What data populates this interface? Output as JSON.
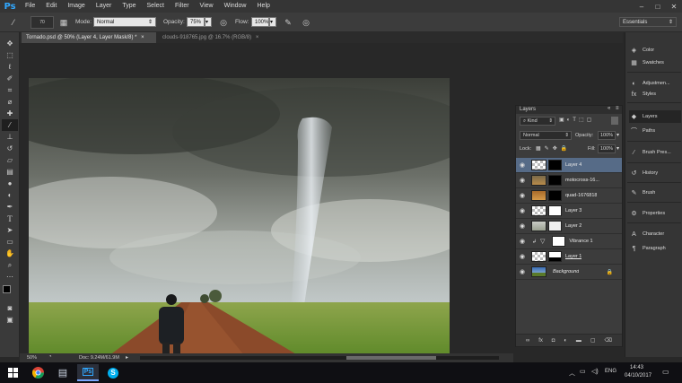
{
  "app": {
    "name": "Ps"
  },
  "menu": [
    "File",
    "Edit",
    "Image",
    "Layer",
    "Type",
    "Select",
    "Filter",
    "View",
    "Window",
    "Help"
  ],
  "window_controls": [
    "–",
    "□",
    "✕"
  ],
  "options": {
    "mode_label": "Mode:",
    "mode_value": "Normal",
    "opacity_label": "Opacity:",
    "opacity_value": "75%",
    "flow_label": "Flow:",
    "flow_value": "100%",
    "brush_size": "70",
    "workspace": "Essentials"
  },
  "tabs": [
    {
      "label": "Tornado.psd @ 50% (Layer 4, Layer Mask/8) *",
      "close": "×"
    },
    {
      "label": "clouds-918765.jpg @ 16.7% (RGB/8)",
      "close": "×"
    }
  ],
  "status": {
    "zoom": "50%",
    "doc": "Doc: 9.24M/61.9M"
  },
  "layers_panel": {
    "title": "Layers",
    "filter_kind": "Kind",
    "blend_mode": "Normal",
    "opacity_label": "Opacity:",
    "opacity_value": "100%",
    "lock_label": "Lock:",
    "fill_label": "Fill:",
    "fill_value": "100%",
    "layers": [
      {
        "name": "Layer 4",
        "selected": true
      },
      {
        "name": "motocross-16..."
      },
      {
        "name": "quad-1676818"
      },
      {
        "name": "Layer 3"
      },
      {
        "name": "Layer 2"
      },
      {
        "name": "Vibrance 1"
      },
      {
        "name": "Layer 1"
      },
      {
        "name": "Background"
      }
    ]
  },
  "right_panels": [
    "Color",
    "Swatches",
    "Adjustmen...",
    "Styles",
    "Layers",
    "Paths",
    "Brush Pres...",
    "History",
    "Brush",
    "Properties",
    "Character",
    "Paragraph"
  ],
  "taskbar": {
    "time": "14:43",
    "date": "04/10/2017",
    "lang": "ENG"
  },
  "colors": {
    "accent": "#31a8ff",
    "selection": "#566b87",
    "panel": "#3c3c3c",
    "canvas_bg": "#282828"
  }
}
